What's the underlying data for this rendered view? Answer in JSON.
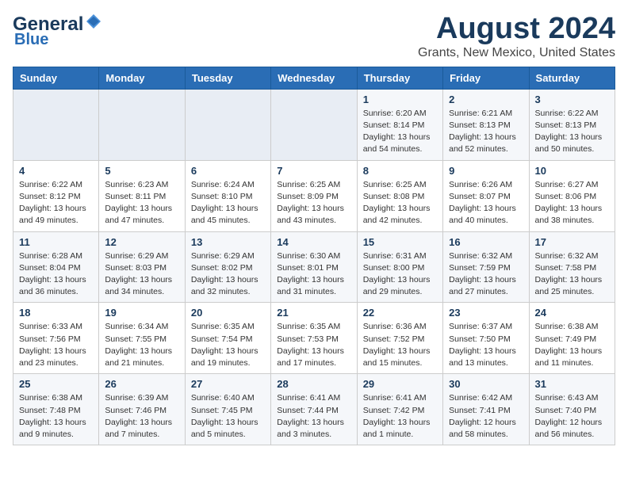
{
  "logo": {
    "line1": "General",
    "line2": "Blue",
    "icon": "▶"
  },
  "title": "August 2024",
  "subtitle": "Grants, New Mexico, United States",
  "weekdays": [
    "Sunday",
    "Monday",
    "Tuesday",
    "Wednesday",
    "Thursday",
    "Friday",
    "Saturday"
  ],
  "weeks": [
    [
      {
        "day": "",
        "info": ""
      },
      {
        "day": "",
        "info": ""
      },
      {
        "day": "",
        "info": ""
      },
      {
        "day": "",
        "info": ""
      },
      {
        "day": "1",
        "info": "Sunrise: 6:20 AM\nSunset: 8:14 PM\nDaylight: 13 hours\nand 54 minutes."
      },
      {
        "day": "2",
        "info": "Sunrise: 6:21 AM\nSunset: 8:13 PM\nDaylight: 13 hours\nand 52 minutes."
      },
      {
        "day": "3",
        "info": "Sunrise: 6:22 AM\nSunset: 8:13 PM\nDaylight: 13 hours\nand 50 minutes."
      }
    ],
    [
      {
        "day": "4",
        "info": "Sunrise: 6:22 AM\nSunset: 8:12 PM\nDaylight: 13 hours\nand 49 minutes."
      },
      {
        "day": "5",
        "info": "Sunrise: 6:23 AM\nSunset: 8:11 PM\nDaylight: 13 hours\nand 47 minutes."
      },
      {
        "day": "6",
        "info": "Sunrise: 6:24 AM\nSunset: 8:10 PM\nDaylight: 13 hours\nand 45 minutes."
      },
      {
        "day": "7",
        "info": "Sunrise: 6:25 AM\nSunset: 8:09 PM\nDaylight: 13 hours\nand 43 minutes."
      },
      {
        "day": "8",
        "info": "Sunrise: 6:25 AM\nSunset: 8:08 PM\nDaylight: 13 hours\nand 42 minutes."
      },
      {
        "day": "9",
        "info": "Sunrise: 6:26 AM\nSunset: 8:07 PM\nDaylight: 13 hours\nand 40 minutes."
      },
      {
        "day": "10",
        "info": "Sunrise: 6:27 AM\nSunset: 8:06 PM\nDaylight: 13 hours\nand 38 minutes."
      }
    ],
    [
      {
        "day": "11",
        "info": "Sunrise: 6:28 AM\nSunset: 8:04 PM\nDaylight: 13 hours\nand 36 minutes."
      },
      {
        "day": "12",
        "info": "Sunrise: 6:29 AM\nSunset: 8:03 PM\nDaylight: 13 hours\nand 34 minutes."
      },
      {
        "day": "13",
        "info": "Sunrise: 6:29 AM\nSunset: 8:02 PM\nDaylight: 13 hours\nand 32 minutes."
      },
      {
        "day": "14",
        "info": "Sunrise: 6:30 AM\nSunset: 8:01 PM\nDaylight: 13 hours\nand 31 minutes."
      },
      {
        "day": "15",
        "info": "Sunrise: 6:31 AM\nSunset: 8:00 PM\nDaylight: 13 hours\nand 29 minutes."
      },
      {
        "day": "16",
        "info": "Sunrise: 6:32 AM\nSunset: 7:59 PM\nDaylight: 13 hours\nand 27 minutes."
      },
      {
        "day": "17",
        "info": "Sunrise: 6:32 AM\nSunset: 7:58 PM\nDaylight: 13 hours\nand 25 minutes."
      }
    ],
    [
      {
        "day": "18",
        "info": "Sunrise: 6:33 AM\nSunset: 7:56 PM\nDaylight: 13 hours\nand 23 minutes."
      },
      {
        "day": "19",
        "info": "Sunrise: 6:34 AM\nSunset: 7:55 PM\nDaylight: 13 hours\nand 21 minutes."
      },
      {
        "day": "20",
        "info": "Sunrise: 6:35 AM\nSunset: 7:54 PM\nDaylight: 13 hours\nand 19 minutes."
      },
      {
        "day": "21",
        "info": "Sunrise: 6:35 AM\nSunset: 7:53 PM\nDaylight: 13 hours\nand 17 minutes."
      },
      {
        "day": "22",
        "info": "Sunrise: 6:36 AM\nSunset: 7:52 PM\nDaylight: 13 hours\nand 15 minutes."
      },
      {
        "day": "23",
        "info": "Sunrise: 6:37 AM\nSunset: 7:50 PM\nDaylight: 13 hours\nand 13 minutes."
      },
      {
        "day": "24",
        "info": "Sunrise: 6:38 AM\nSunset: 7:49 PM\nDaylight: 13 hours\nand 11 minutes."
      }
    ],
    [
      {
        "day": "25",
        "info": "Sunrise: 6:38 AM\nSunset: 7:48 PM\nDaylight: 13 hours\nand 9 minutes."
      },
      {
        "day": "26",
        "info": "Sunrise: 6:39 AM\nSunset: 7:46 PM\nDaylight: 13 hours\nand 7 minutes."
      },
      {
        "day": "27",
        "info": "Sunrise: 6:40 AM\nSunset: 7:45 PM\nDaylight: 13 hours\nand 5 minutes."
      },
      {
        "day": "28",
        "info": "Sunrise: 6:41 AM\nSunset: 7:44 PM\nDaylight: 13 hours\nand 3 minutes."
      },
      {
        "day": "29",
        "info": "Sunrise: 6:41 AM\nSunset: 7:42 PM\nDaylight: 13 hours\nand 1 minute."
      },
      {
        "day": "30",
        "info": "Sunrise: 6:42 AM\nSunset: 7:41 PM\nDaylight: 12 hours\nand 58 minutes."
      },
      {
        "day": "31",
        "info": "Sunrise: 6:43 AM\nSunset: 7:40 PM\nDaylight: 12 hours\nand 56 minutes."
      }
    ]
  ]
}
